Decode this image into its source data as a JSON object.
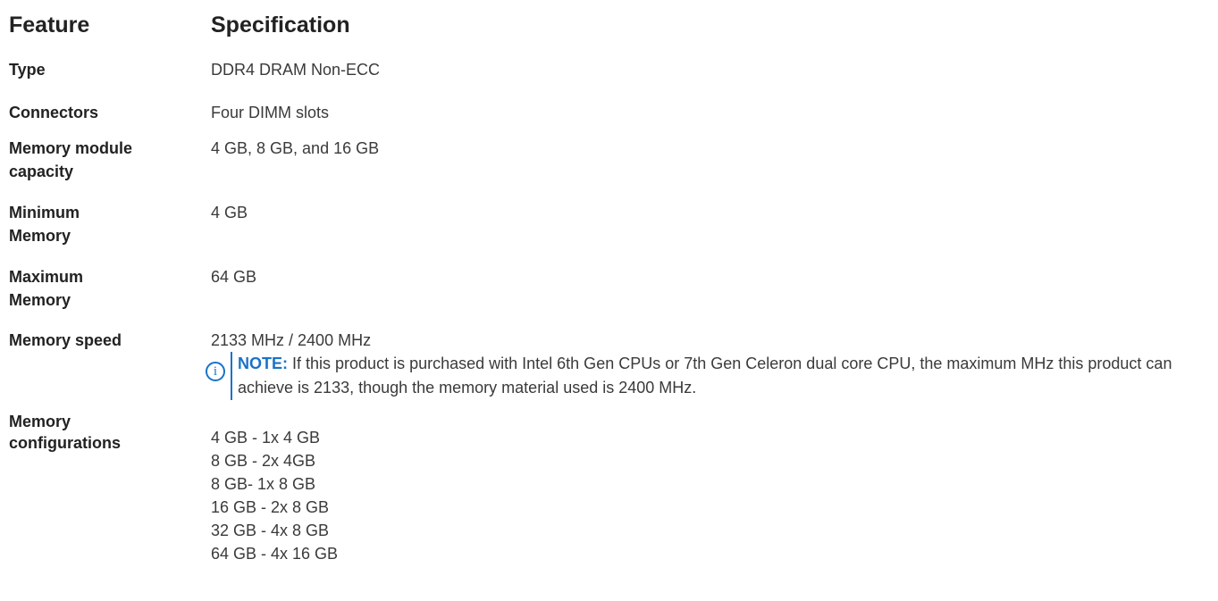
{
  "header": {
    "feature": "Feature",
    "specification": "Specification"
  },
  "rows": {
    "type": {
      "feature": "Type",
      "spec": "DDR4 DRAM Non-ECC"
    },
    "connectors": {
      "feature": "Connectors",
      "spec": "Four DIMM slots"
    },
    "capacity": {
      "feature": "Memory module capacity",
      "spec": "4 GB, 8 GB, and 16 GB"
    },
    "minimum": {
      "feature": "Minimum Memory",
      "spec": "4 GB"
    },
    "maximum": {
      "feature": "Maximum Memory",
      "spec": "64 GB"
    },
    "speed": {
      "feature": "Memory speed",
      "spec": "2133 MHz / 2400 MHz",
      "note_label": "NOTE:",
      "note_text": "If this product is purchased with Intel 6th Gen CPUs or 7th Gen Celeron dual core CPU, the maximum MHz this product can achieve is 2133, though the memory material used is 2400 MHz."
    },
    "configurations": {
      "feature": "Memory configurations",
      "items": [
        "4 GB - 1x 4 GB",
        "8 GB - 2x 4GB",
        "8 GB- 1x 8 GB",
        "16 GB - 2x 8 GB",
        "32 GB - 4x 8 GB",
        "64 GB - 4x 16 GB"
      ]
    }
  },
  "icons": {
    "note_icon": "info-icon",
    "note_icon_glyph": "i"
  },
  "colors": {
    "note_accent": "#1a72c8",
    "text": "#222222"
  }
}
